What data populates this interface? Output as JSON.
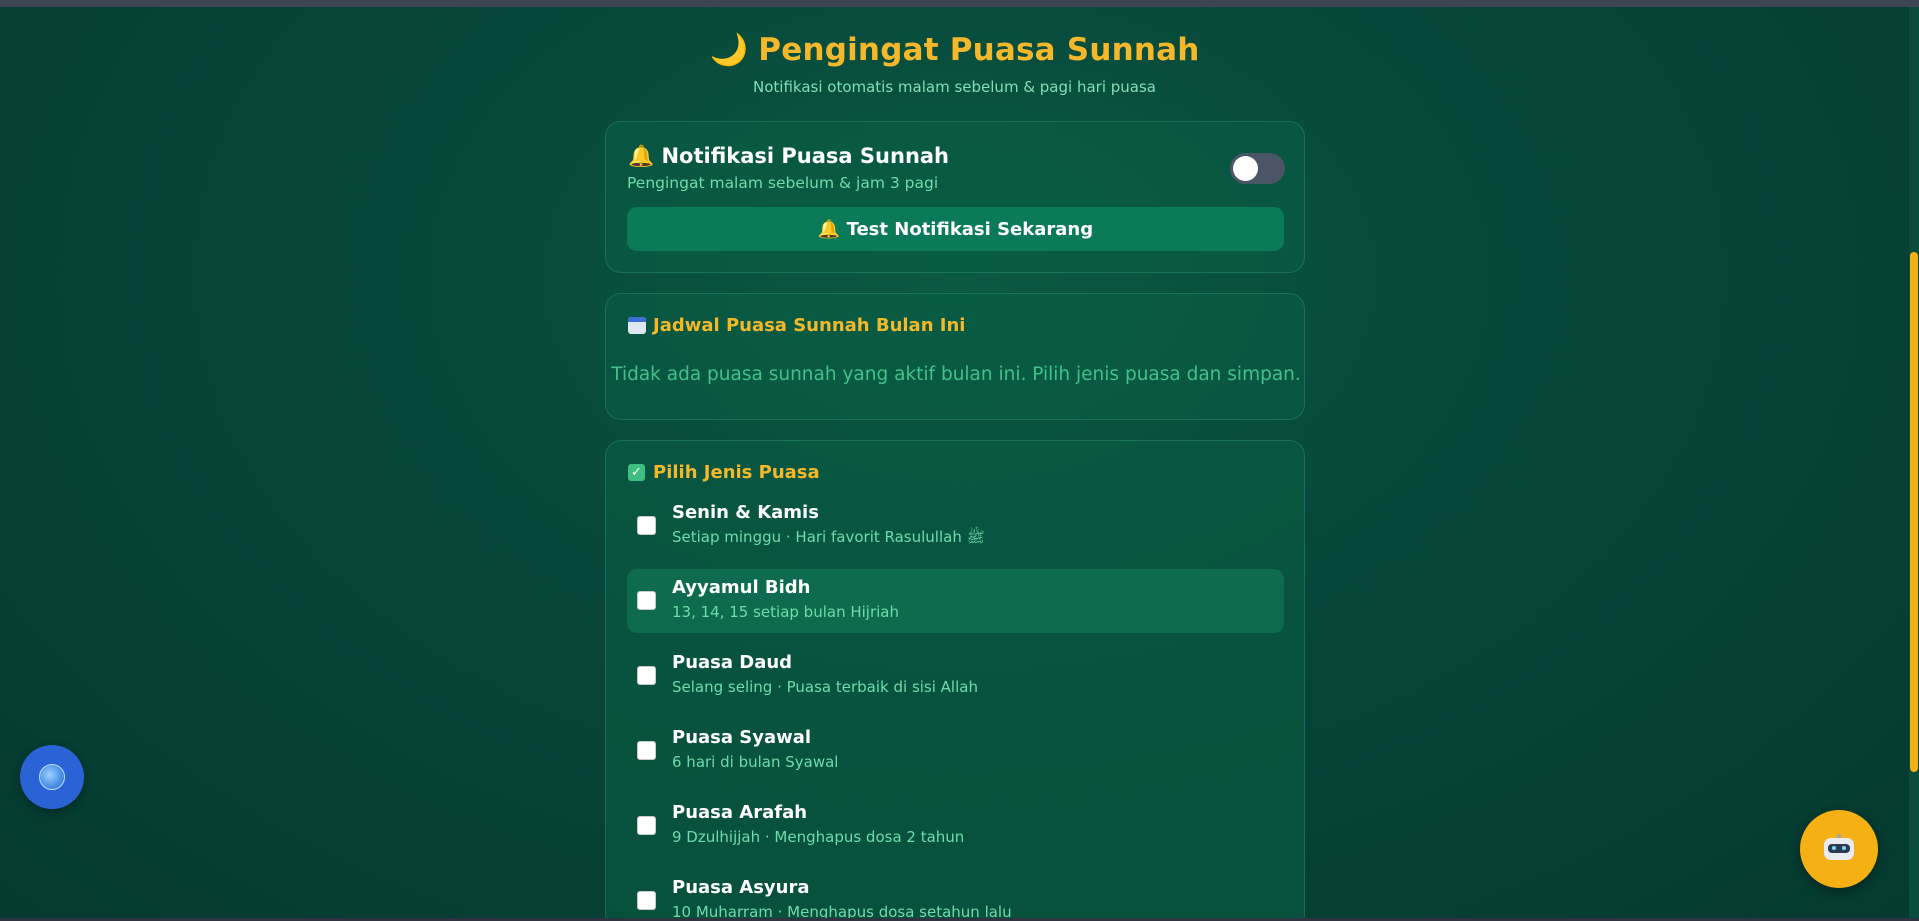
{
  "header": {
    "moon_icon": "🌙",
    "title": "Pengingat Puasa Sunnah",
    "subtitle": "Notifikasi otomatis malam sebelum & pagi hari puasa"
  },
  "notification_card": {
    "bell_icon": "🔔",
    "title": "Notifikasi Puasa Sunnah",
    "subtitle": "Pengingat malam sebelum & jam 3 pagi",
    "toggle_enabled": false,
    "test_button_label": "🔔 Test Notifikasi Sekarang"
  },
  "schedule_card": {
    "title": "Jadwal Puasa Sunnah Bulan Ini",
    "empty_message": "Tidak ada puasa sunnah yang aktif bulan ini. Pilih jenis puasa dan simpan."
  },
  "options_card": {
    "title": "Pilih Jenis Puasa",
    "options": [
      {
        "name": "Senin & Kamis",
        "desc": "Setiap minggu · Hari favorit Rasulullah ﷺ",
        "checked": false
      },
      {
        "name": "Ayyamul Bidh",
        "desc": "13, 14, 15 setiap bulan Hijriah",
        "checked": false
      },
      {
        "name": "Puasa Daud",
        "desc": "Selang seling · Puasa terbaik di sisi Allah",
        "checked": false
      },
      {
        "name": "Puasa Syawal",
        "desc": "6 hari di bulan Syawal",
        "checked": false
      },
      {
        "name": "Puasa Arafah",
        "desc": "9 Dzulhijjah · Menghapus dosa 2 tahun",
        "checked": false
      },
      {
        "name": "Puasa Asyura",
        "desc": "10 Muharram · Menghapus dosa setahun lalu",
        "checked": false
      }
    ]
  },
  "colors": {
    "accent": "#f5b82a",
    "background": "#07473a",
    "button": "#0b7a58",
    "muted_text": "#6ddcaa"
  },
  "floating": {
    "left_button_icon": "globe-icon",
    "right_button_icon": "robot-icon"
  }
}
